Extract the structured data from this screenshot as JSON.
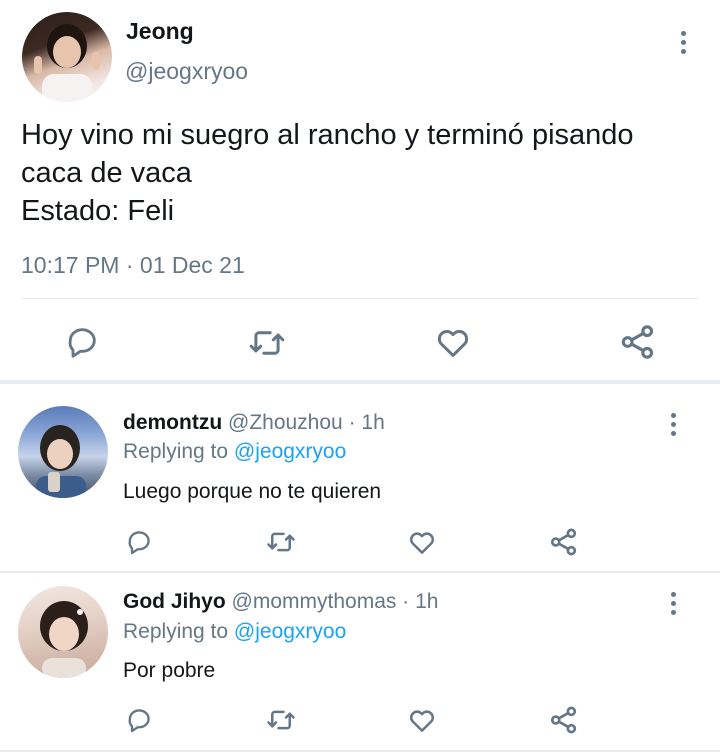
{
  "main_tweet": {
    "display_name": "Jeong",
    "handle": "@jeogxryoo",
    "text_lines": [
      "Hoy vino mi suegro al rancho y terminó pisando",
      "caca de vaca",
      "Estado: Feli"
    ],
    "time": "10:17 PM",
    "separator": "·",
    "date": "01 Dec 21"
  },
  "replies": [
    {
      "display_name": "demontzu",
      "handle": "@Zhouzhou",
      "separator": "·",
      "age": "1h",
      "replying_prefix": "Replying to",
      "replying_handle": "@jeogxryoo",
      "text": "Luego porque no te quieren"
    },
    {
      "display_name": "God Jihyo",
      "handle": "@mommythomas",
      "separator": "·",
      "age": "1h",
      "replying_prefix": "Replying to",
      "replying_handle": "@jeogxryoo",
      "text": "Por pobre"
    }
  ],
  "colors": {
    "icon_gray": "#657786",
    "link_blue": "#1da1f2",
    "divider": "#e6ecf0"
  },
  "icons": [
    "reply-icon",
    "retweet-icon",
    "like-icon",
    "share-icon",
    "more-options-icon"
  ]
}
